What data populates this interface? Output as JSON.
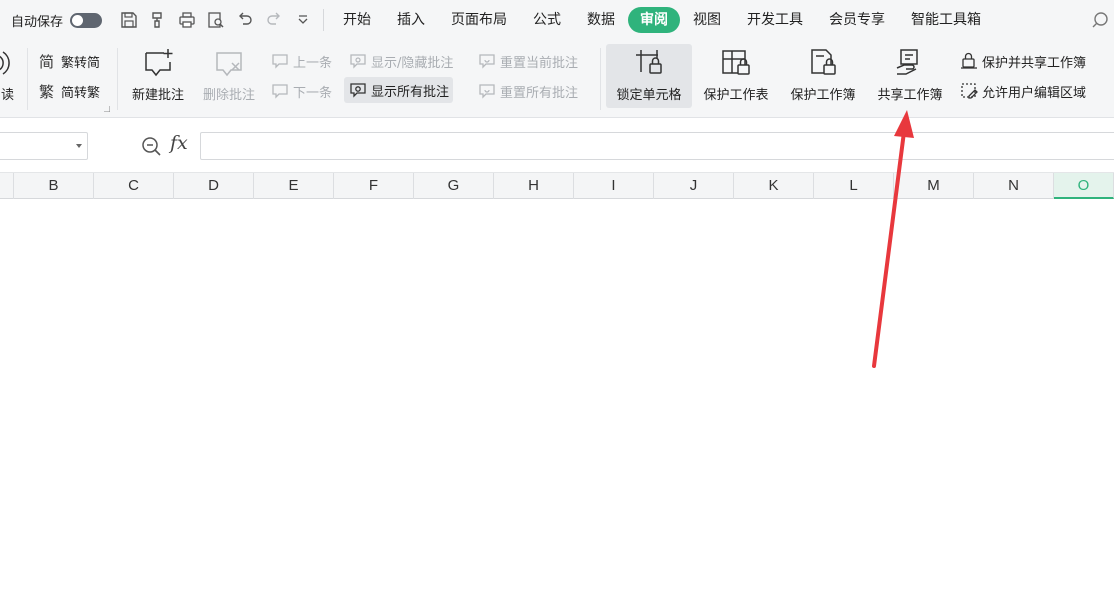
{
  "quick_access": {
    "autosave_label": "自动保存",
    "icons": [
      "save-icon",
      "format-painter-icon",
      "print-icon",
      "print-preview-icon",
      "undo-icon",
      "redo-icon",
      "more-dropdown-icon"
    ]
  },
  "menu": {
    "items": [
      "开始",
      "插入",
      "页面布局",
      "公式",
      "数据",
      "审阅",
      "视图",
      "开发工具",
      "会员专享",
      "智能工具箱"
    ],
    "active": "审阅"
  },
  "ribbon": {
    "read_aloud_partial": "朗读",
    "trad_to_simp": "繁转简",
    "simp_to_trad": "简转繁",
    "new_comment": "新建批注",
    "delete_comment": "删除批注",
    "prev": "上一条",
    "next": "下一条",
    "show_hide_comment": "显示/隐藏批注",
    "show_all_comments": "显示所有批注",
    "reset_current_comment": "重置当前批注",
    "reset_all_comments": "重置所有批注",
    "lock_cell": "锁定单元格",
    "protect_sheet": "保护工作表",
    "protect_workbook": "保护工作簿",
    "share_workbook": "共享工作簿",
    "protect_and_share": "保护并共享工作簿",
    "allow_edit_ranges": "允许用户编辑区域"
  },
  "formula_bar": {
    "name_box_value": "",
    "fx_label": "fx",
    "formula_value": ""
  },
  "columns": [
    "B",
    "C",
    "D",
    "E",
    "F",
    "G",
    "H",
    "I",
    "J",
    "K",
    "L",
    "M",
    "N",
    "O"
  ],
  "active_column": "O",
  "colors": {
    "accent": "#2fb37c",
    "annotation_arrow": "#e8383d"
  }
}
